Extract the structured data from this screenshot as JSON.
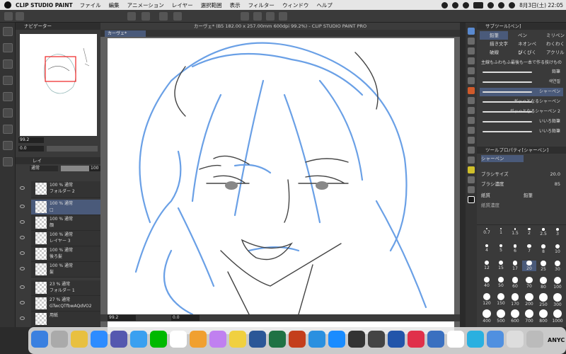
{
  "menubar": {
    "app": "CLIP STUDIO PAINT",
    "items": [
      "ファイル",
      "編集",
      "アニメーション",
      "レイヤー",
      "選択範囲",
      "表示",
      "フィルター",
      "ウィンドウ",
      "ヘルプ"
    ],
    "datetime": "8月3日(土) 22:05"
  },
  "navigator": {
    "title": "ナビゲーター",
    "zoom": "99.2",
    "angle": "0.0"
  },
  "layers": {
    "tab": "レイ",
    "blend_mode": "通常",
    "opacity": "100",
    "items": [
      {
        "name": "100 % 通常\nフォルダー 2"
      },
      {
        "name": "100 % 通常\n□"
      },
      {
        "name": "100 % 通常\n顔"
      },
      {
        "name": "100 % 通常\nレイヤー 3"
      },
      {
        "name": "100 % 通常\n後ろ髪"
      },
      {
        "name": "100 % 通常\n髪"
      },
      {
        "name": "23 % 通常\nフォルダー 1"
      },
      {
        "name": "27 % 通常\nGTwcQTfbwAQdVO2"
      },
      {
        "name": "用紙"
      }
    ]
  },
  "canvas": {
    "window_title": "カーヴェ* (B5 182.00 x 257.00mm 600dpi 99.2%) - CLIP STUDIO PAINT PRO",
    "tab": "カーヴェ*",
    "status_zoom": "99.2",
    "status_angle": "0.0"
  },
  "subtool": {
    "title": "サブツール[ペン]",
    "tabs": [
      "鉛筆",
      "ペン",
      "ミリペン",
      "描き文字",
      "ネオンペン",
      "わくわく",
      "破線",
      "ぴくぴく",
      "アクリル"
    ],
    "group_label": "主線もふわもふ最後も一本で作る技けもの",
    "brushes": [
      "鉛筆",
      "색연필",
      "シャーペン",
      "ガッっとなるシャーペン",
      "ガッっとなるシャーペン 2",
      "いいろ鉛筆",
      "いいろ鉛筆"
    ]
  },
  "toolprop": {
    "title": "ツールプロパティ[シャーペン]",
    "tool": "シャーペン",
    "brush_size_label": "ブラシサイズ",
    "brush_size": "20.0",
    "density_label": "ブラシ濃度",
    "density": "85",
    "paper_label": "紙質",
    "paper_value": "鉛筆",
    "texture_label": "紙質濃度"
  },
  "brushsize": {
    "values": [
      "0.7",
      "1",
      "1.5",
      "2",
      "2.5",
      "3",
      "4",
      "5",
      "6",
      "7",
      "8",
      "10",
      "12",
      "15",
      "17",
      "20",
      "25",
      "30",
      "40",
      "50",
      "60",
      "70",
      "80",
      "100",
      "120",
      "150",
      "170",
      "200",
      "250",
      "300",
      "400",
      "500",
      "600",
      "700",
      "800",
      "1000"
    ]
  },
  "dock": {
    "label": "ANYC"
  }
}
